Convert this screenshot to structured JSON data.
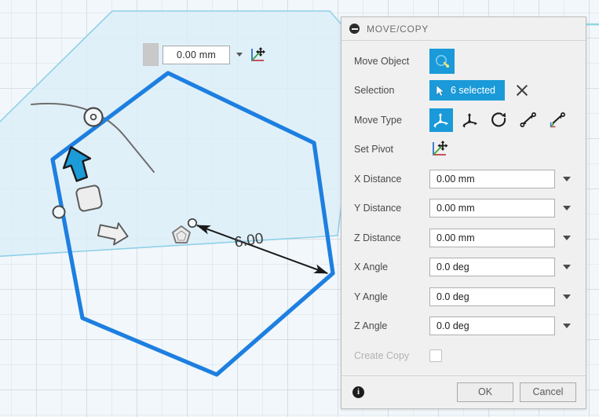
{
  "canvas": {
    "toolbar": {
      "color_swatch_name": "color-swatch",
      "value": "0.00 mm",
      "placeholder": "0.00 mm",
      "caret_name": "dropdown-caret",
      "pivot_icon_name": "move-pivot-icon"
    },
    "annotations": {
      "dimension_value": "6.00"
    },
    "colors": {
      "sketch_blue": "#1d7fe0",
      "preview_blue": "#8fd0e8",
      "preview_fill": "#ddeef8",
      "grid_line": "#c4ccd4",
      "background": "#f2f7fb",
      "accent": "#1a9ad8"
    },
    "glyphs": {
      "cursor_arrow_name": "blue-cursor-arrow",
      "rounded_square_name": "rounded-square-handle",
      "white_arrow_name": "white-arrow-handle",
      "pentagon_name": "pentagon-handle",
      "vertex_circle_name": "vertex-circle-handle",
      "rotate_handle_name": "rotate-handle"
    }
  },
  "panel": {
    "title": "MOVE/COPY",
    "collapse_icon": "collapse-minus-icon",
    "rows": {
      "move_object": {
        "label": "Move Object",
        "icon": "move-object-icon"
      },
      "selection": {
        "label": "Selection",
        "chip_text": "6 selected",
        "chip_icon": "cursor-arrow-icon",
        "clear_icon": "clear-selection-x-icon"
      },
      "move_type": {
        "label": "Move Type",
        "options": [
          {
            "name": "translate-rotate-icon",
            "active": true
          },
          {
            "name": "translate-icon",
            "active": false
          },
          {
            "name": "rotate-icon",
            "active": false
          },
          {
            "name": "point-to-point-icon",
            "active": false
          },
          {
            "name": "point-to-position-icon",
            "active": false
          }
        ]
      },
      "set_pivot": {
        "label": "Set Pivot",
        "icon": "set-pivot-icon"
      }
    },
    "fields": [
      {
        "label": "X Distance",
        "value": "0.00 mm",
        "placeholder": "0.00 mm",
        "name": "x-distance"
      },
      {
        "label": "Y Distance",
        "value": "0.00 mm",
        "placeholder": "0.00 mm",
        "name": "y-distance"
      },
      {
        "label": "Z Distance",
        "value": "0.00 mm",
        "placeholder": "0.00 mm",
        "name": "z-distance"
      },
      {
        "label": "X Angle",
        "value": "0.0 deg",
        "placeholder": "0.0 deg",
        "name": "x-angle"
      },
      {
        "label": "Y Angle",
        "value": "0.0 deg",
        "placeholder": "0.0 deg",
        "name": "y-angle"
      },
      {
        "label": "Z Angle",
        "value": "0.0 deg",
        "placeholder": "0.0 deg",
        "name": "z-angle"
      }
    ],
    "create_copy": {
      "label": "Create Copy",
      "checked": false,
      "enabled": false
    },
    "footer": {
      "info_icon": "info-icon",
      "info_glyph": "i",
      "ok_label": "OK",
      "cancel_label": "Cancel"
    }
  }
}
